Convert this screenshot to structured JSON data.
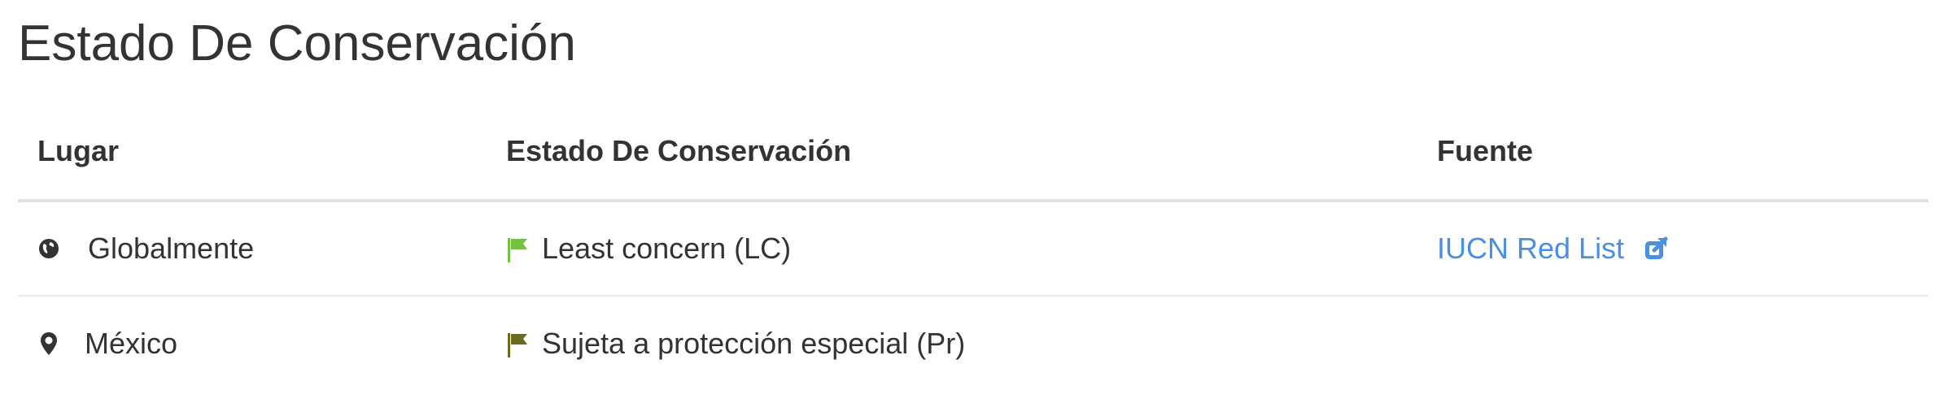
{
  "section": {
    "title": "Estado De Conservación"
  },
  "table": {
    "headers": {
      "place": "Lugar",
      "status": "Estado De Conservación",
      "source": "Fuente"
    },
    "rows": [
      {
        "place": "Globalmente",
        "place_icon": "globe-icon",
        "status": "Least concern (LC)",
        "status_flag_color": "#76c043",
        "source": "IUCN Red List",
        "source_icon": "external-link-icon"
      },
      {
        "place": "México",
        "place_icon": "map-pin-icon",
        "status": "Sujeta a protección especial (Pr)",
        "status_flag_color": "#6b6b1f",
        "source": ""
      }
    ]
  },
  "colors": {
    "text": "#333333",
    "link": "#4a90e2",
    "divider": "#dde3e6"
  }
}
